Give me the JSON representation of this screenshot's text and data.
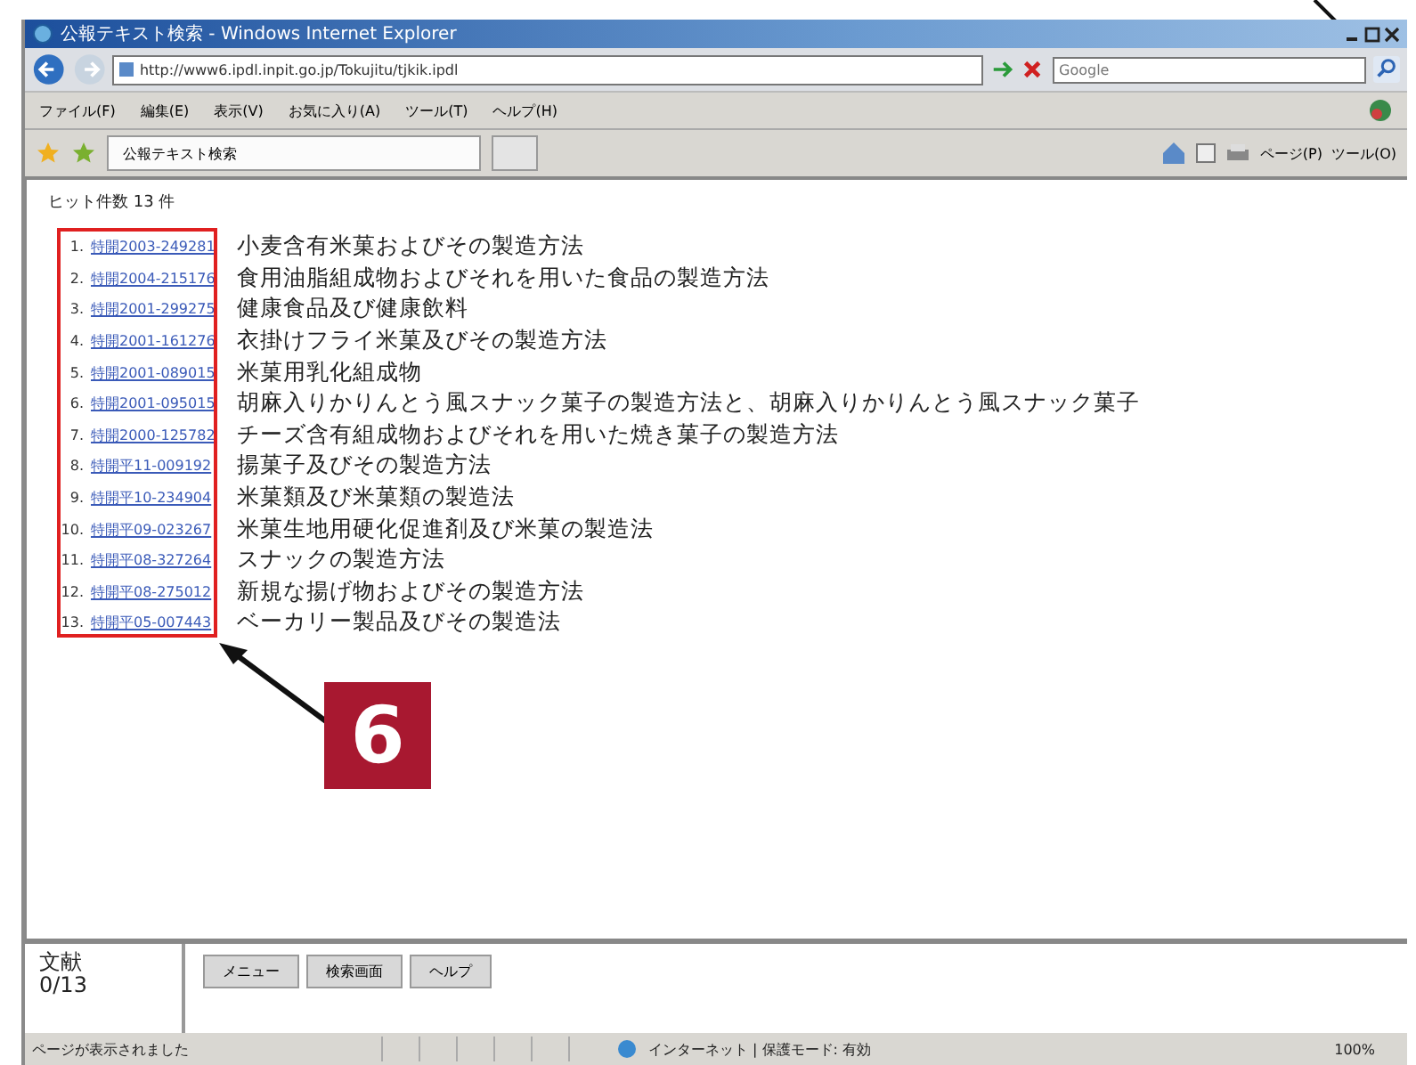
{
  "window": {
    "title": "公報テキスト検索 - Windows Internet Explorer"
  },
  "address_bar": {
    "url": "http://www6.ipdl.inpit.go.jp/Tokujitu/tjkik.ipdl"
  },
  "search": {
    "placeholder": "Google"
  },
  "menu": [
    "ファイル(F)",
    "編集(E)",
    "表示(V)",
    "お気に入り(A)",
    "ツール(T)",
    "ヘルプ(H)"
  ],
  "tabs": [
    {
      "label": "公報テキスト検索",
      "selected": true
    }
  ],
  "command_bar": [
    "ページ(P)",
    "ツール(O)"
  ],
  "hit_count": "ヒット件数 13 件",
  "results": [
    {
      "index": "1.",
      "number": "特開2003-249281",
      "title": "小麦含有米菓およびその製造方法"
    },
    {
      "index": "2.",
      "number": "特開2004-215176",
      "title": "食用油脂組成物およびそれを用いた食品の製造方法"
    },
    {
      "index": "3.",
      "number": "特開2001-299275",
      "title": "健康食品及び健康飲料"
    },
    {
      "index": "4.",
      "number": "特開2001-161276",
      "title": "衣掛けフライ米菓及びその製造方法"
    },
    {
      "index": "5.",
      "number": "特開2001-089015",
      "title": "米菓用乳化組成物"
    },
    {
      "index": "6.",
      "number": "特開2001-095015",
      "title": "胡麻入りかりんとう風スナック菓子の製造方法と、胡麻入りかりんとう風スナック菓子"
    },
    {
      "index": "7.",
      "number": "特開2000-125782",
      "title": "チーズ含有組成物およびそれを用いた焼き菓子の製造方法"
    },
    {
      "index": "8.",
      "number": "特開平11-009192",
      "title": "揚菓子及びその製造方法"
    },
    {
      "index": "9.",
      "number": "特開平10-234904",
      "title": "米菓類及び米菓類の製造法"
    },
    {
      "index": "10.",
      "number": "特開平09-023267",
      "title": "米菓生地用硬化促進剤及び米菓の製造法"
    },
    {
      "index": "11.",
      "number": "特開平08-327264",
      "title": "スナックの製造方法"
    },
    {
      "index": "12.",
      "number": "特開平08-275012",
      "title": "新規な揚げ物およびその製造方法"
    },
    {
      "index": "13.",
      "number": "特開平05-007443",
      "title": "ベーカリー製品及びその製造法"
    }
  ],
  "bottom_panel": {
    "label": "文献",
    "count": "0/13",
    "buttons": [
      "メニュー",
      "検索画面",
      "ヘルプ"
    ]
  },
  "status_bar": {
    "text": "ページが表示されました",
    "zone": "インターネット | 保護モード: 有効",
    "zoom": "100%"
  },
  "annotation": {
    "badge": "6"
  }
}
